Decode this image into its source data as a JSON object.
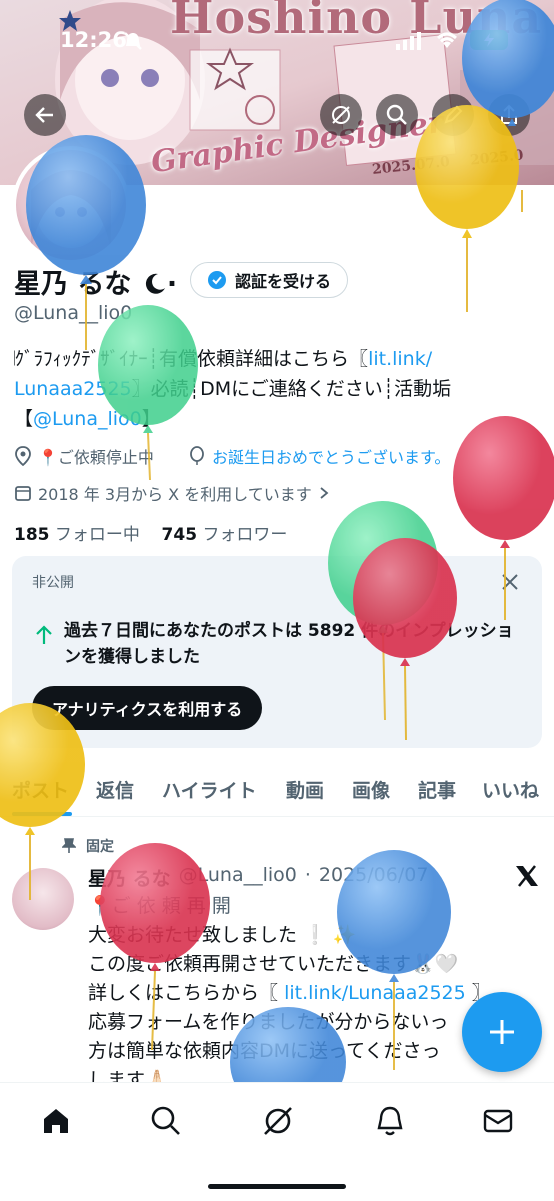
{
  "status_bar": {
    "time": "12:26"
  },
  "banner": {
    "title": "Hoshino Luna",
    "subtitle": "Graphic Designer",
    "date_left": "2025.07.0",
    "date_right": "2025.0"
  },
  "profile": {
    "name": "星乃 るな",
    "name_suffix": "·",
    "verify_button": "認証を受ける",
    "handle": "@Luna__lio0",
    "bio_line1_prefix": "𝄀ｸﾞﾗﾌｨｯｸﾃﾞｻﾞｲﾅｰ┊有償依頼詳細はこちら〖",
    "bio_link1a": "lit.link/",
    "bio_link1b": "Lunaaa2525",
    "bio_line2_rest": "〗必読┊DMにご連絡ください┊活動垢",
    "bio_line3_open": "【",
    "bio_link2": "@Luna_lio0",
    "bio_line3_close": "】",
    "location": "📍ご依頼停止中",
    "website": "お誕生日おめでとうございます。",
    "joined": "2018 年 3月から X を利用しています",
    "following_count": "185",
    "following_label": "フォロー中",
    "followers_count": "745",
    "followers_label": "フォロワー"
  },
  "analytics_card": {
    "label": "非公開",
    "text": "過去７日間にあなたのポストは 5892 件のインプレッションを獲得しました",
    "button": "アナリティクスを利用する"
  },
  "tabs": [
    "ポスト",
    "返信",
    "ハイライト",
    "動画",
    "画像",
    "記事",
    "いいね"
  ],
  "post": {
    "pinned_label": "固定",
    "author": "星乃 るな",
    "handle": "@Luna__lio0",
    "date": "2025/06/07",
    "lines": [
      "📍ご 依 頼 再 開",
      "大変お待たせ致しました ❕ ✨",
      "この度ご依頼再開させていただきます🐰🤍",
      "詳しくはこちらから〖",
      "応募フォームを作りましたが分からないっ",
      "方は簡単な依頼内容DMに送ってくださっ",
      "します🙏🏻"
    ],
    "link": "lit.link/Lunaaa2525",
    "link_close": "〗"
  },
  "colors": {
    "accent": "#1d9bf0",
    "balloon_blue": "#4a90e2",
    "balloon_yellow": "#f5c518",
    "balloon_green": "#4dd69a",
    "balloon_red": "#e0405f"
  },
  "icons": {
    "back": "back-arrow-icon",
    "grok": "grok-icon",
    "search": "search-icon",
    "edit": "edit-icon",
    "share": "share-icon",
    "close": "close-icon",
    "fab": "plus-icon"
  }
}
